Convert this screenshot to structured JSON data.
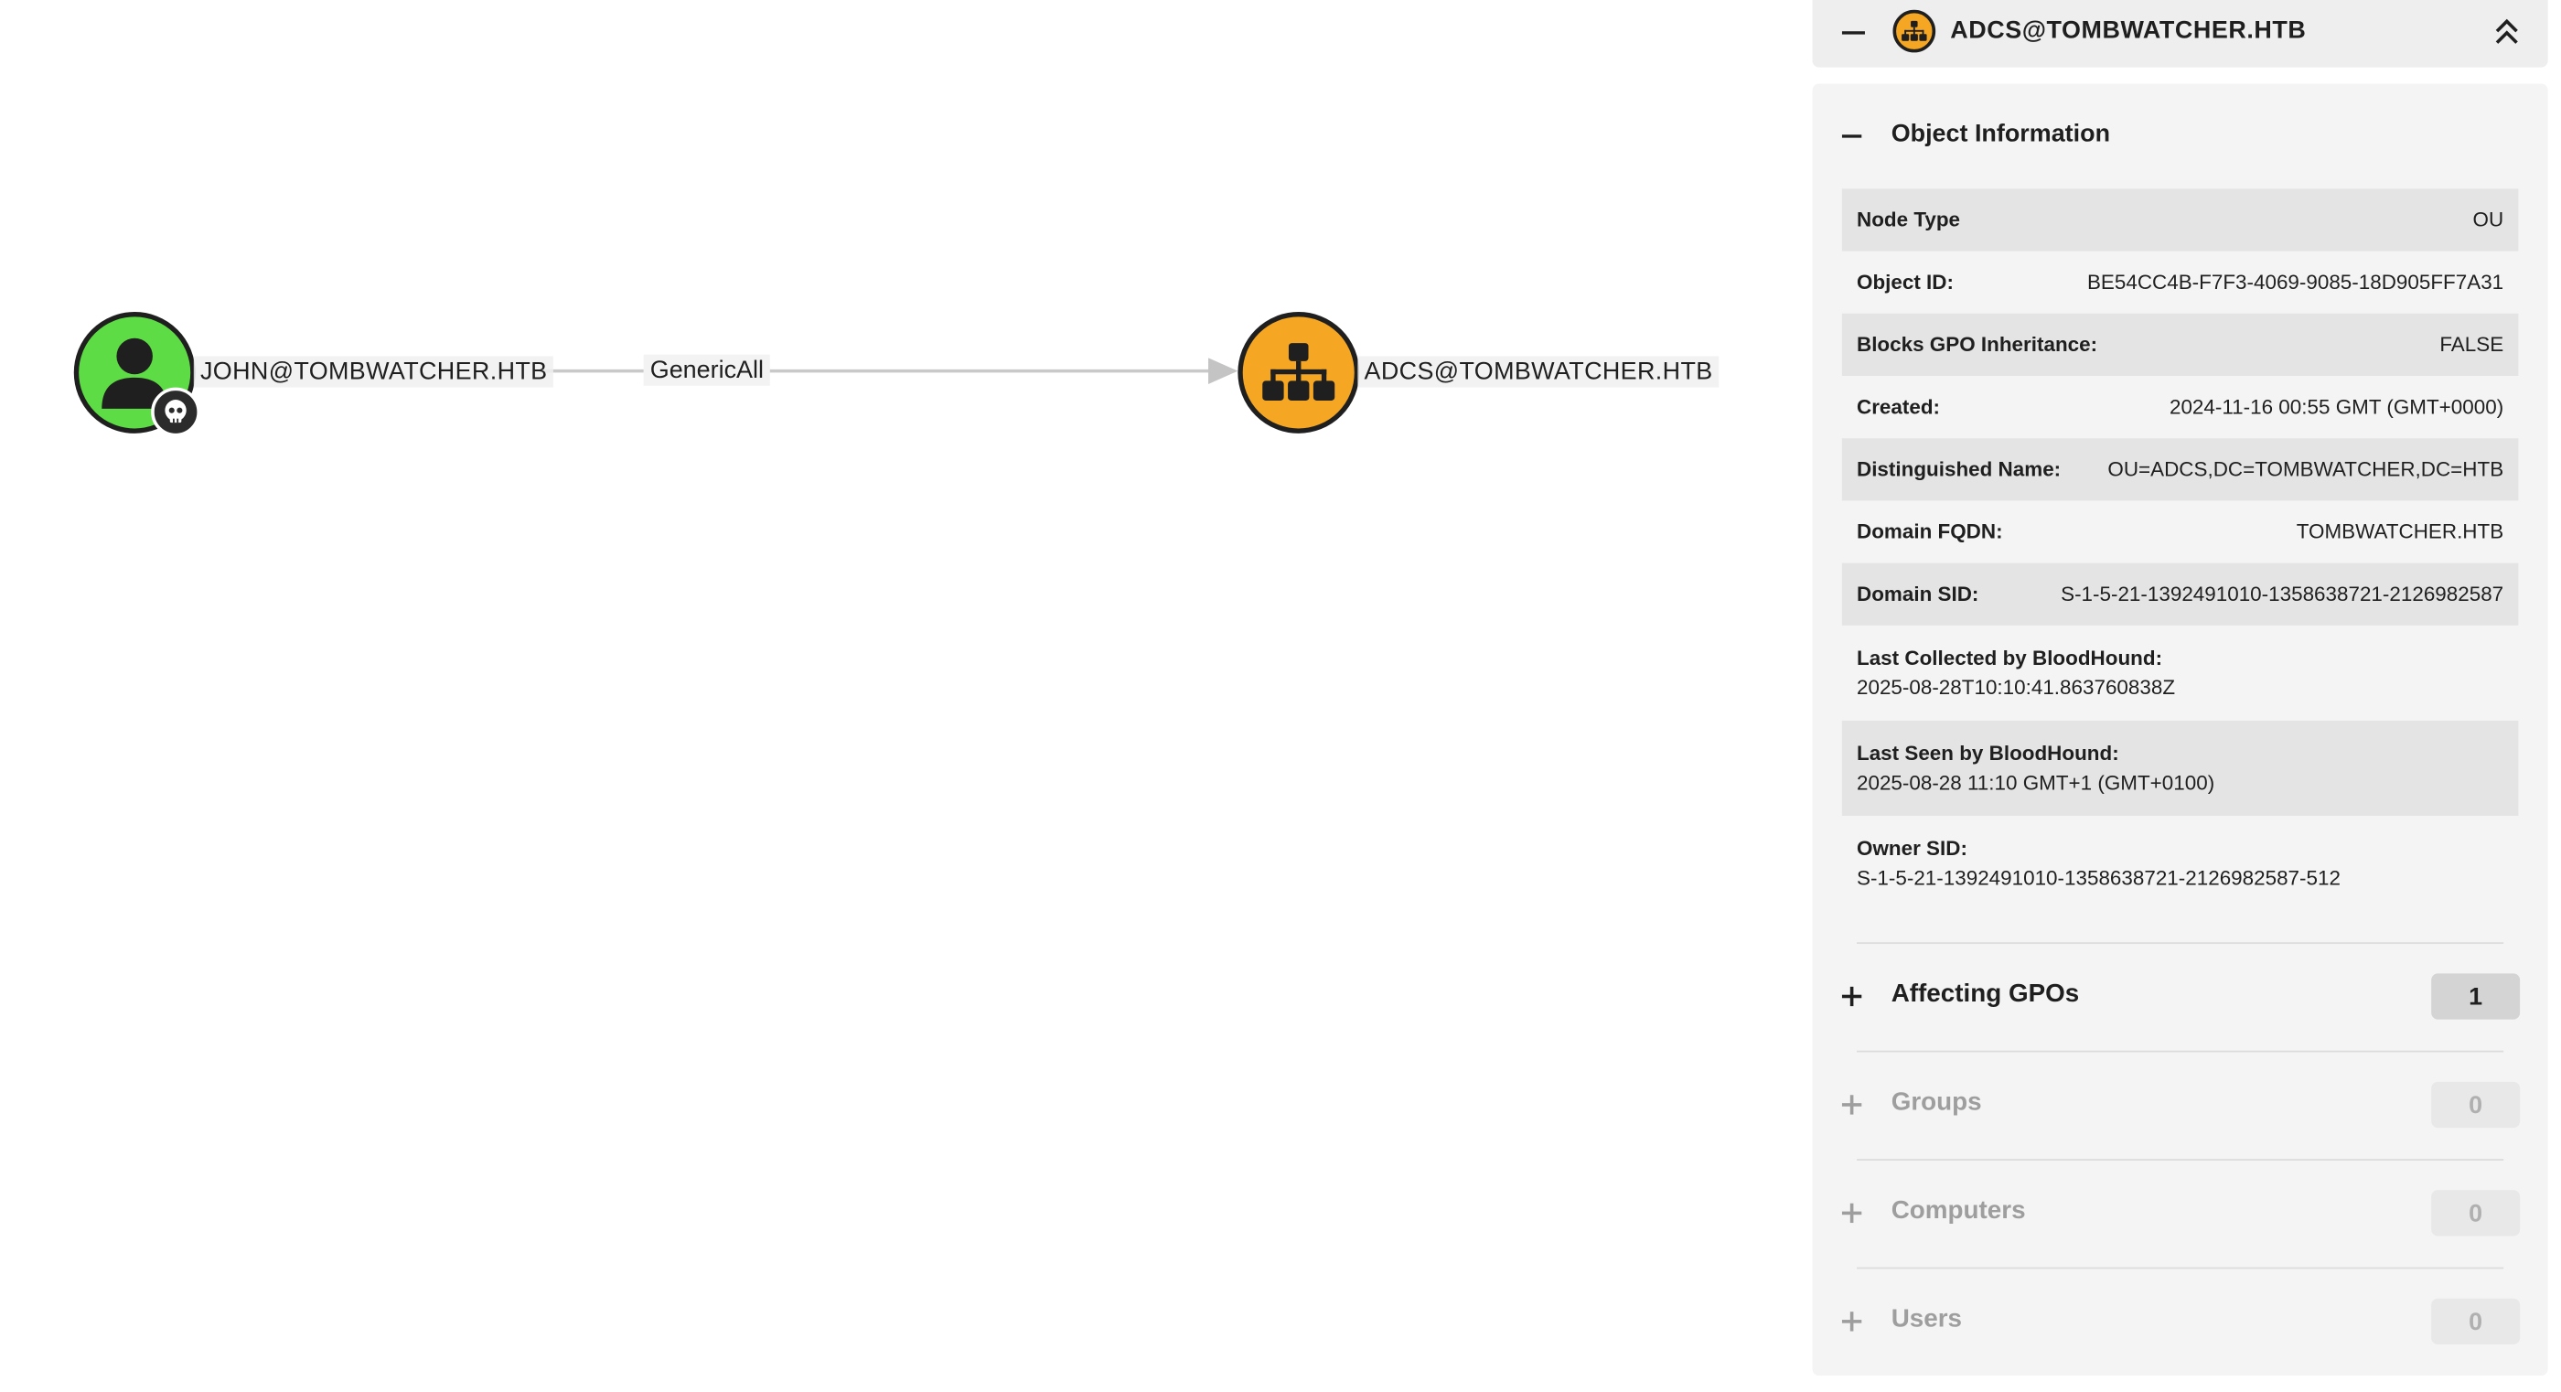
{
  "graph": {
    "source_node": {
      "label": "JOHN@TOMBWATCHER.HTB",
      "icon": "user-icon",
      "badge": "skull-icon",
      "color": "#5ddc45"
    },
    "target_node": {
      "label": "ADCS@TOMBWATCHER.HTB",
      "icon": "org-chart-icon",
      "color": "#f5a623"
    },
    "edge": {
      "label": "GenericAll"
    }
  },
  "panel": {
    "header": {
      "title": "ADCS@TOMBWATCHER.HTB",
      "icon": "org-chart-icon"
    },
    "object_information": {
      "title": "Object Information",
      "rows": [
        {
          "key": "Node Type",
          "value": "OU"
        },
        {
          "key": "Object ID:",
          "value": "BE54CC4B-F7F3-4069-9085-18D905FF7A31"
        },
        {
          "key": "Blocks GPO Inheritance:",
          "value": "FALSE"
        },
        {
          "key": "Created:",
          "value": "2024-11-16 00:55 GMT (GMT+0000)"
        },
        {
          "key": "Distinguished Name:",
          "value": "OU=ADCS,DC=TOMBWATCHER,DC=HTB"
        },
        {
          "key": "Domain FQDN:",
          "value": "TOMBWATCHER.HTB"
        },
        {
          "key": "Domain SID:",
          "value": "S-1-5-21-1392491010-1358638721-2126982587"
        },
        {
          "key": "Last Collected by BloodHound:",
          "value": "2025-08-28T10:10:41.863760838Z"
        },
        {
          "key": "Last Seen by BloodHound:",
          "value": "2025-08-28 11:10 GMT+1 (GMT+0100)"
        },
        {
          "key": "Owner SID:",
          "value": "S-1-5-21-1392491010-1358638721-2126982587-512"
        }
      ]
    },
    "sections": [
      {
        "label": "Affecting GPOs",
        "count": "1"
      },
      {
        "label": "Groups",
        "count": "0"
      },
      {
        "label": "Computers",
        "count": "0"
      },
      {
        "label": "Users",
        "count": "0"
      }
    ]
  }
}
